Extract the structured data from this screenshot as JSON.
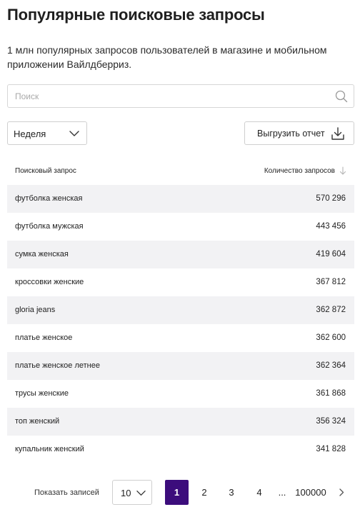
{
  "page": {
    "title": "Популярные поисковые запросы",
    "description": "1 млн популярных запросов пользователей в магазине и мобильном приложении Вайлдберриз."
  },
  "search": {
    "placeholder": "Поиск",
    "value": "",
    "icon": "search-icon"
  },
  "filters": {
    "period_selected": "Неделя",
    "period_icon": "chevron-down-icon"
  },
  "export": {
    "label": "Выгрузить отчет",
    "icon": "download-icon"
  },
  "table": {
    "columns": {
      "query": "Поисковый запрос",
      "count": "Количество запросов",
      "sort_icon": "sort-arrow-down-icon"
    },
    "rows": [
      {
        "query": "футболка женская",
        "count": "570 296"
      },
      {
        "query": "футболка мужская",
        "count": "443 456"
      },
      {
        "query": "сумка женская",
        "count": "419 604"
      },
      {
        "query": "кроссовки женские",
        "count": "367 812"
      },
      {
        "query": "gloria jeans",
        "count": "362 872"
      },
      {
        "query": "платье женское",
        "count": "362 600"
      },
      {
        "query": "платье женское летнее",
        "count": "362 364"
      },
      {
        "query": "трусы женские",
        "count": "361 868"
      },
      {
        "query": "топ женский",
        "count": "356 324"
      },
      {
        "query": "купальник женский",
        "count": "341 828"
      }
    ]
  },
  "pagination": {
    "page_size_label": "Показать записей",
    "page_size_value": "10",
    "pages": [
      "1",
      "2",
      "3",
      "4"
    ],
    "current_page": "1",
    "ellipsis": "...",
    "last_page": "100000",
    "next_icon": "chevron-right-icon"
  },
  "colors": {
    "accent": "#3c0d7c",
    "row_stripe": "#f2f2f4",
    "border": "#cfcfcf"
  }
}
